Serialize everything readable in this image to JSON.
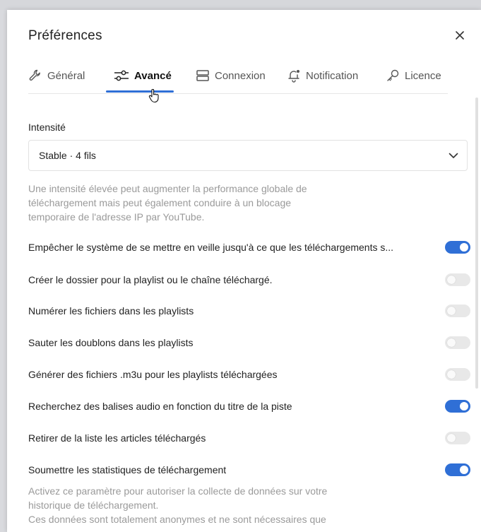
{
  "dialog": {
    "title": "Préférences"
  },
  "tabs": [
    {
      "label": "Général",
      "icon": "wrench-icon",
      "active": false
    },
    {
      "label": "Avancé",
      "icon": "sliders-icon",
      "active": true
    },
    {
      "label": "Connexion",
      "icon": "server-icon",
      "active": false
    },
    {
      "label": "Notification",
      "icon": "bell-icon",
      "active": false
    },
    {
      "label": "Licence",
      "icon": "key-icon",
      "active": false
    }
  ],
  "intensity": {
    "label": "Intensité",
    "selected": "Stable · 4 fils",
    "help": [
      "Une intensité élevée peut augmenter la performance globale de",
      "téléchargement mais peut également conduire à un blocage",
      "temporaire de l'adresse IP par YouTube."
    ]
  },
  "settings": [
    {
      "label": "Empêcher le système de se mettre en veille jusqu'à ce que les téléchargements s...",
      "enabled": true
    },
    {
      "label": "Créer le dossier pour la playlist ou le chaîne téléchargé.",
      "enabled": false
    },
    {
      "label": "Numérer les fichiers dans les playlists",
      "enabled": false
    },
    {
      "label": "Sauter les doublons dans les playlists",
      "enabled": false
    },
    {
      "label": "Générer des fichiers .m3u pour les playlists téléchargées",
      "enabled": false
    },
    {
      "label": "Recherchez des balises audio en fonction du titre de la piste",
      "enabled": true
    },
    {
      "label": "Retirer de la liste les articles téléchargés",
      "enabled": false
    },
    {
      "label": "Soumettre les statistiques de téléchargement",
      "enabled": true
    }
  ],
  "stats_help": [
    "Activez ce paramètre pour autoriser la collecte de données sur votre",
    "historique de téléchargement.",
    "Ces données sont totalement anonymes et ne sont nécessaires que"
  ],
  "colors": {
    "accent": "#2f6fd6",
    "toggle_off": "#e8e8e8",
    "muted_text": "#9a9a9a"
  }
}
